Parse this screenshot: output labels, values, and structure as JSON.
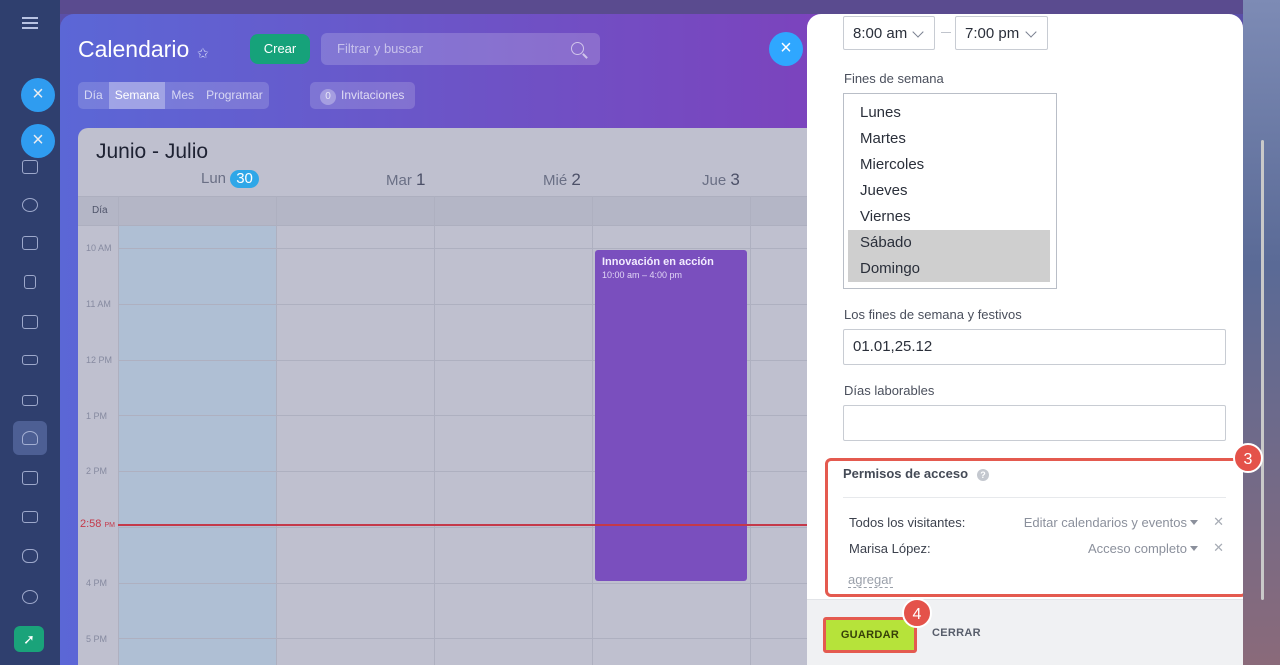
{
  "calendar": {
    "title": "Calendario",
    "create_label": "Crear",
    "search_placeholder": "Filtrar y buscar",
    "view_tabs": [
      "Día",
      "Semana",
      "Mes",
      "Programar"
    ],
    "selected_view": "Semana",
    "invitations_count": "0",
    "invitations_label": "Invitaciones",
    "range_title": "Junio - Julio",
    "days": [
      {
        "name": "Lun",
        "num": "30"
      },
      {
        "name": "Mar",
        "num": "1"
      },
      {
        "name": "Mié",
        "num": "2"
      },
      {
        "name": "Jue",
        "num": "3"
      }
    ],
    "allday_label": "Día",
    "hours": [
      "10 AM",
      "11 AM",
      "12 PM",
      "1 PM",
      "2 PM",
      "4 PM",
      "5 PM"
    ],
    "now_time": "2:58",
    "now_ampm": "PM",
    "event": {
      "title": "Innovación en acción",
      "time": "10:00 am – 4:00 pm"
    }
  },
  "settings": {
    "work_start": "8:00 am",
    "work_end": "7:00 pm",
    "weekend_label": "Fines de semana",
    "weekdays": [
      {
        "label": "Lunes",
        "selected": false
      },
      {
        "label": "Martes",
        "selected": false
      },
      {
        "label": "Miercoles",
        "selected": false
      },
      {
        "label": "Jueves",
        "selected": false
      },
      {
        "label": "Viernes",
        "selected": false
      },
      {
        "label": "Sábado",
        "selected": true
      },
      {
        "label": "Domingo",
        "selected": true
      }
    ],
    "holidays_label": "Los fines de semana y festivos",
    "holidays_value": "01.01,25.12",
    "workdays_label": "Días laborables",
    "workdays_value": "",
    "permissions_title": "Permisos de acceso",
    "permissions_help": "?",
    "permissions": [
      {
        "who": "Todos los visitantes:",
        "level": "Editar calendarios y eventos"
      },
      {
        "who": "Marisa López:",
        "level": "Acceso completo"
      }
    ],
    "add_label": "agregar",
    "save_label": "GUARDAR",
    "close_label": "CERRAR",
    "annotation_3": "3",
    "annotation_4": "4"
  },
  "colors": {
    "accent_blue": "#2fa7ff",
    "save_green": "#b6e33a",
    "annotation_red": "#e4524a",
    "event_purple": "#7a4fbe",
    "now_line": "#c4394a"
  },
  "icons": [
    "menu-icon",
    "close-icon",
    "pin-icon",
    "search-icon",
    "help-icon",
    "chevron-down-icon",
    "rocket-icon"
  ]
}
